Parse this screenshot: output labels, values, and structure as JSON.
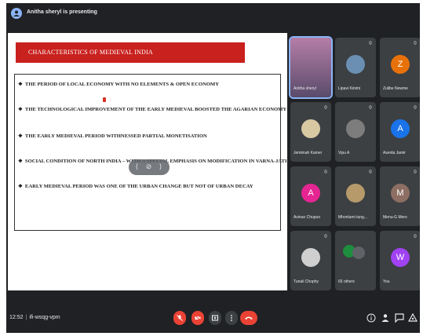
{
  "presenting_banner": "Anitha sheryl is presenting",
  "slide": {
    "title": "CHARACTERISTICS OF MEDIEVAL INDIA",
    "points": [
      "THE PERIOD OF LOCAL ECONOMY WITH NO ELEMENTS & OPEN ECONOMY",
      "THE TECHNOLOGICAL IMPROVEMENT OF THE EARLY MEDIEVAL BOOSTED THE AGARIAN ECONOMY",
      "THE EARLY MEDIEVAL PERIOD WITHNESSED PARTIAL MONETISATION",
      "SOCIAL CONDITION OF NORTH INDIA – WITH A SPECIAL EMPHASIS ON MODIFICATION IN VARNA-JATI SYSTEM",
      "EARLY MEDIEVAL PERIOD WAS ONE OF THE URBAN CHANGE BUT NOT OF URBAN DECAY"
    ],
    "bullet": "❖"
  },
  "participants": [
    {
      "name": "Anitha sheryl",
      "avatar": "",
      "color": "",
      "kind": "video"
    },
    {
      "name": "Lipavi Kinimi",
      "avatar": "",
      "color": "",
      "kind": "photo"
    },
    {
      "name": "Zulibe Newme",
      "avatar": "Z",
      "color": "#e8710a",
      "kind": "letter"
    },
    {
      "name": "Jemimah Kamei",
      "avatar": "",
      "color": "",
      "kind": "photo"
    },
    {
      "name": "Vipu A",
      "avatar": "",
      "color": "",
      "kind": "photo"
    },
    {
      "name": "Asenla Jamir",
      "avatar": "A",
      "color": "#1a73e8",
      "kind": "letter"
    },
    {
      "name": "Avinuo Chupuo",
      "avatar": "A",
      "color": "#e52592",
      "kind": "letter"
    },
    {
      "name": "Mhonlumi tung...",
      "avatar": "",
      "color": "",
      "kind": "photo"
    },
    {
      "name": "Menu-G Mero",
      "avatar": "M",
      "color": "#8d6e63",
      "kind": "letter"
    },
    {
      "name": "Tunali Chophy",
      "avatar": "",
      "color": "",
      "kind": "photo"
    },
    {
      "name": "65 others",
      "avatar": "",
      "color": "#1e8e3e",
      "kind": "others"
    },
    {
      "name": "You",
      "avatar": "W",
      "color": "#a142f4",
      "kind": "letter"
    }
  ],
  "bottom": {
    "time": "12:52",
    "separator": "|",
    "meeting_code": "ifi-wsqg-vpm"
  },
  "overlay_controls": [
    "⟨",
    "⊘",
    "⟩"
  ]
}
